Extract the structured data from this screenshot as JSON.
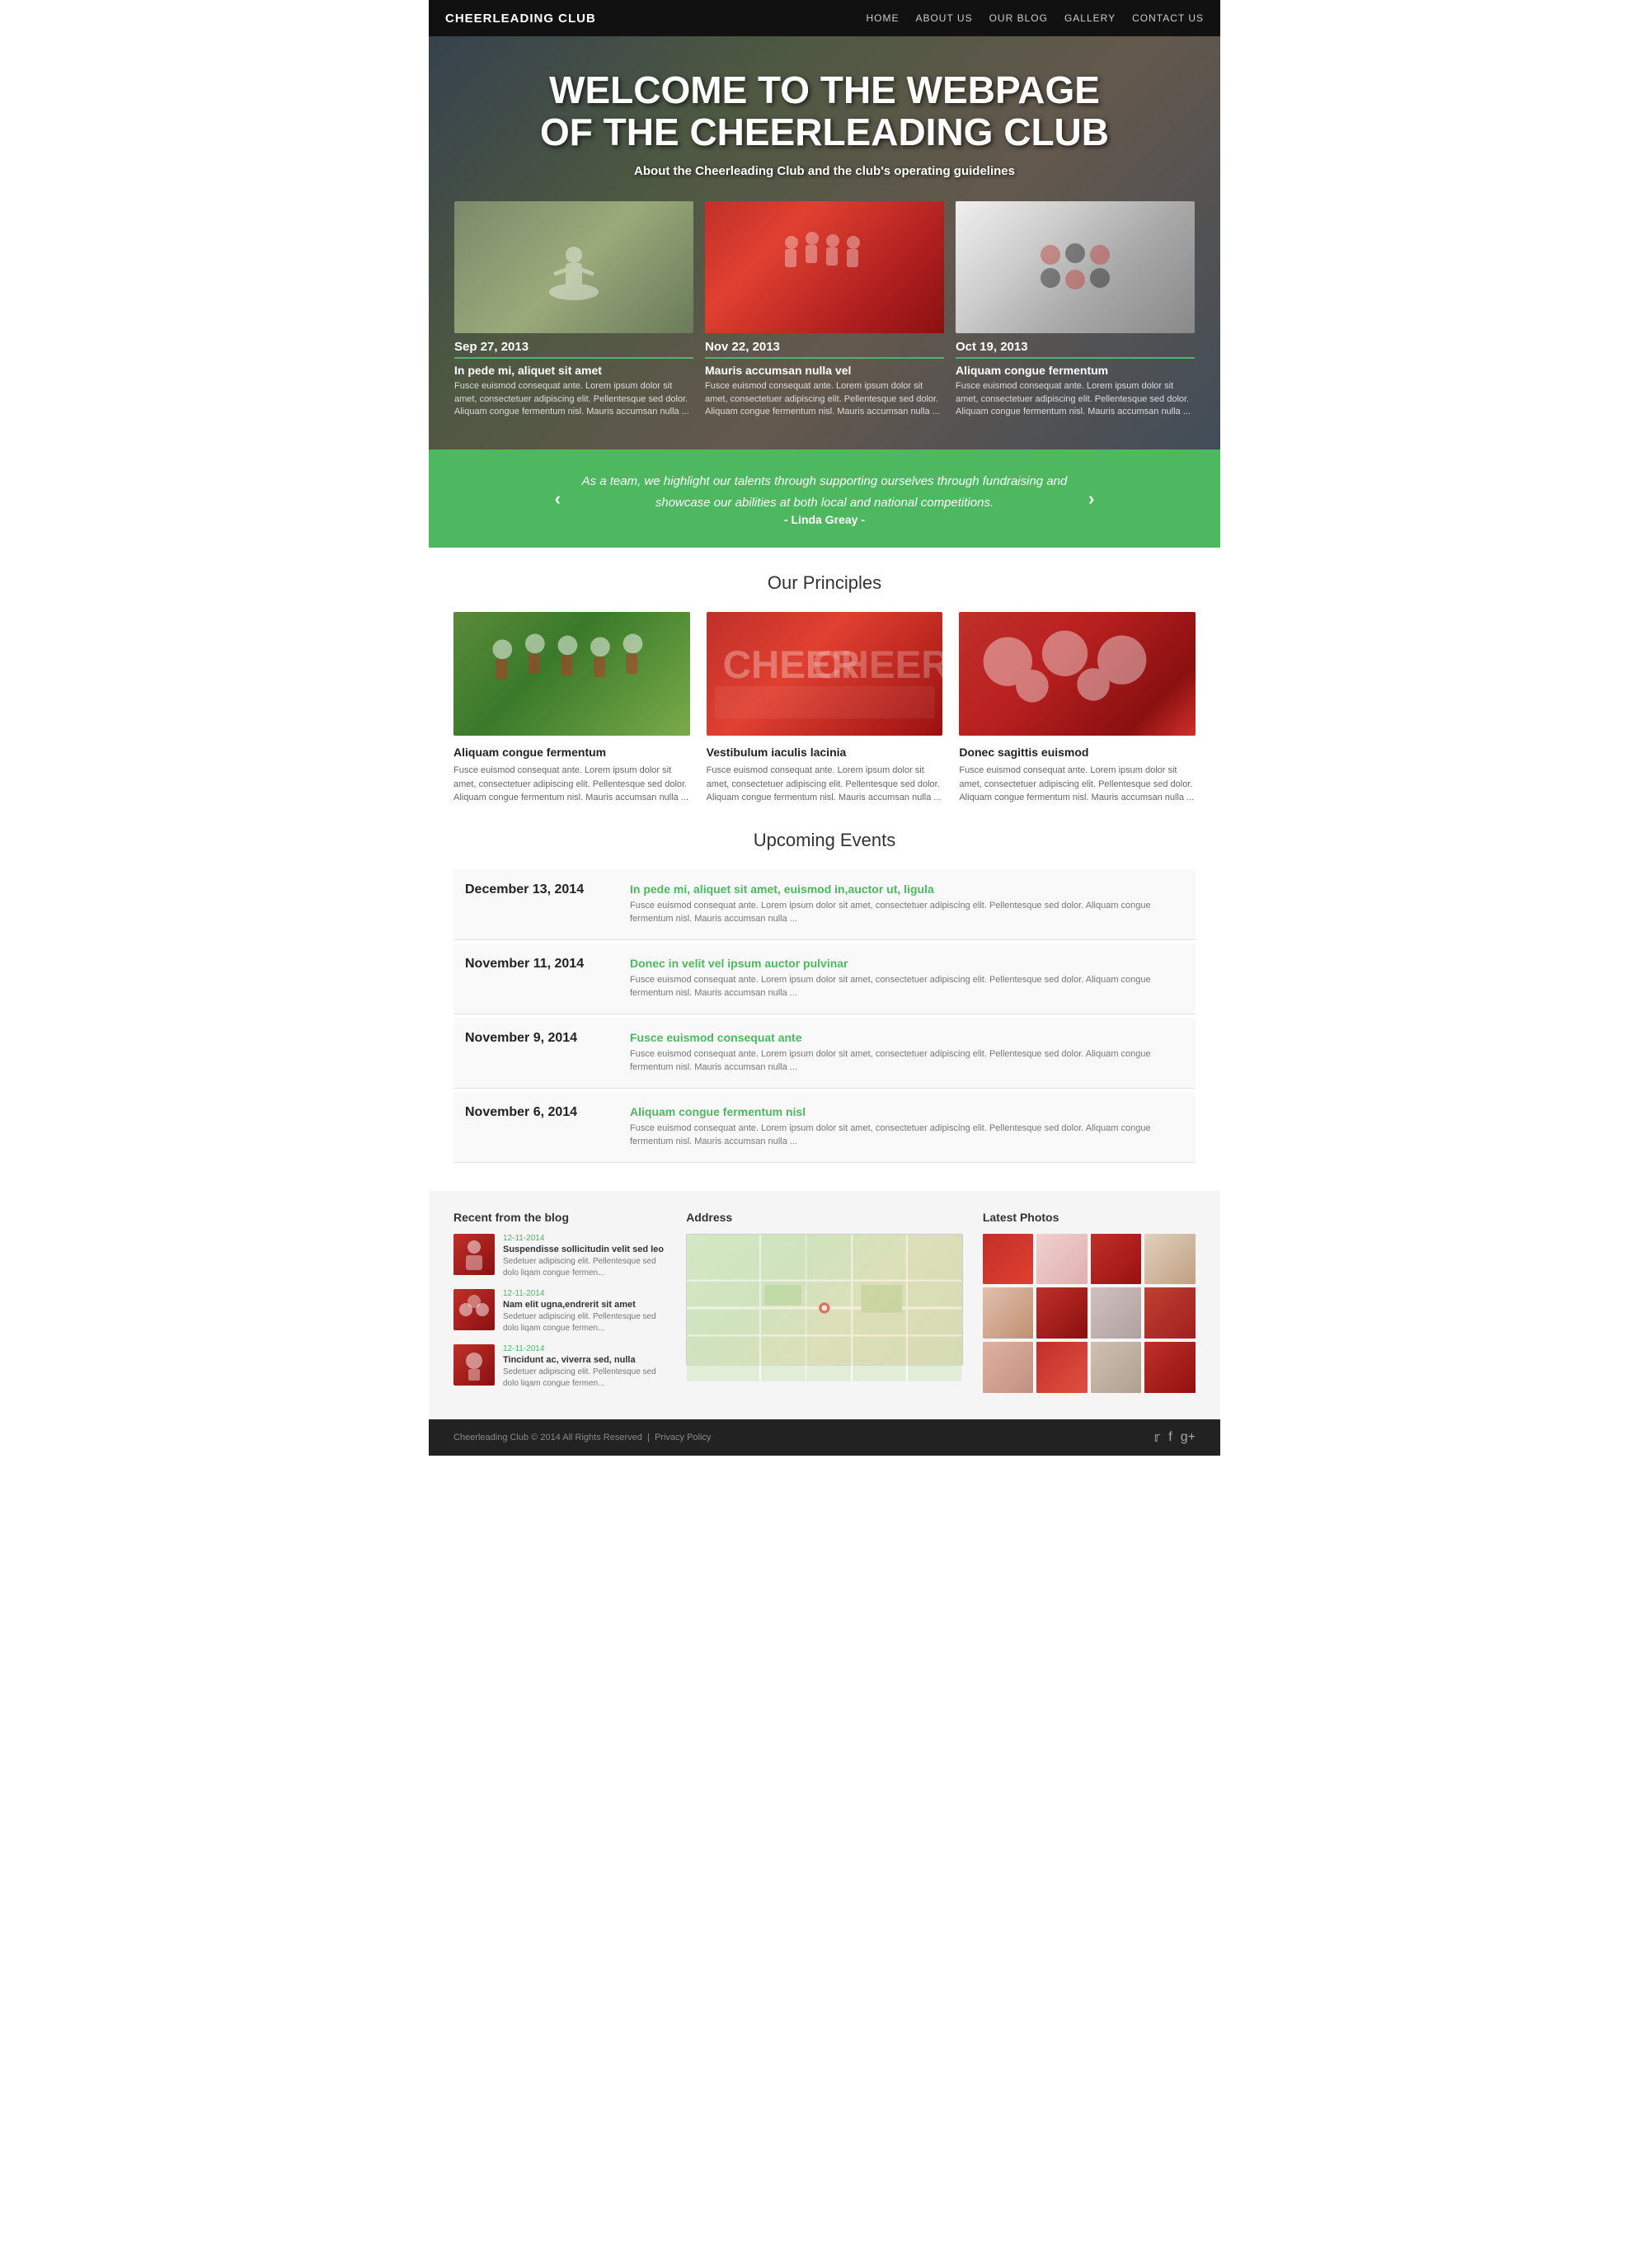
{
  "header": {
    "logo": "CHEERLEADING CLUB",
    "nav": [
      "HOME",
      "ABOUT US",
      "OUR BLOG",
      "GALLERY",
      "CONTACT US"
    ]
  },
  "hero": {
    "title": "WELCOME TO THE WEBPAGE OF THE CHEERLEADING CLUB",
    "subtitle": "About the Cheerleading Club and the club's operating guidelines",
    "cards": [
      {
        "date": "Sep 27, 2013",
        "title": "In pede mi, aliquet sit amet",
        "text": "Fusce euismod consequat ante. Lorem ipsum dolor sit amet, consectetuer adipiscing elit. Pellentesque sed dolor. Aliquam congue fermentum nisl. Mauris accumsan nulla ..."
      },
      {
        "date": "Nov 22, 2013",
        "title": "Mauris accumsan nulla vel",
        "text": "Fusce euismod consequat ante. Lorem ipsum dolor sit amet, consectetuer adipiscing elit. Pellentesque sed dolor. Aliquam congue fermentum nisl. Mauris accumsan nulla ..."
      },
      {
        "date": "Oct 19, 2013",
        "title": "Aliquam congue fermentum",
        "text": "Fusce euismod consequat ante. Lorem ipsum dolor sit amet, consectetuer adipiscing elit. Pellentesque sed dolor. Aliquam congue fermentum nisl. Mauris accumsan nulla ..."
      }
    ]
  },
  "quote": {
    "text": "As a team, we highlight our talents through supporting ourselves through fundraising and showcase our abilities at both local and national competitions.",
    "author": "- Linda Greay -"
  },
  "principles": {
    "title": "Our Principles",
    "items": [
      {
        "name": "Aliquam congue fermentum",
        "text": "Fusce euismod consequat ante. Lorem ipsum dolor sit amet, consectetuer adipiscing elit. Pellentesque sed dolor. Aliquam congue fermentum nisl. Mauris accumsan nulla ..."
      },
      {
        "name": "Vestibulum iaculis lacinia",
        "text": "Fusce euismod consequat ante. Lorem ipsum dolor sit amet, consectetuer adipiscing elit. Pellentesque sed dolor. Aliquam congue fermentum nisl. Mauris accumsan nulla ..."
      },
      {
        "name": "Donec sagittis euismod",
        "text": "Fusce euismod consequat ante. Lorem ipsum dolor sit amet, consectetuer adipiscing elit. Pellentesque sed dolor. Aliquam congue fermentum nisl. Mauris accumsan nulla ..."
      }
    ]
  },
  "events": {
    "title": "Upcoming Events",
    "items": [
      {
        "date": "December 13, 2014",
        "title": "In pede mi, aliquet sit amet, euismod in,auctor ut, ligula",
        "desc": "Fusce euismod consequat ante. Lorem ipsum dolor sit amet, consectetuer adipiscing elit. Pellentesque sed dolor. Aliquam congue fermentum nisl. Mauris accumsan nulla ..."
      },
      {
        "date": "November 11, 2014",
        "title": "Donec in velit vel ipsum auctor pulvinar",
        "desc": "Fusce euismod consequat ante. Lorem ipsum dolor sit amet, consectetuer adipiscing elit. Pellentesque sed dolor. Aliquam congue fermentum nisl. Mauris accumsan nulla ..."
      },
      {
        "date": "November 9, 2014",
        "title": "Fusce euismod consequat ante",
        "desc": "Fusce euismod consequat ante. Lorem ipsum dolor sit amet, consectetuer adipiscing elit. Pellentesque sed dolor. Aliquam congue fermentum nisl. Mauris accumsan nulla ..."
      },
      {
        "date": "November 6, 2014",
        "title": "Aliquam congue fermentum nisl",
        "desc": "Fusce euismod consequat ante. Lorem ipsum dolor sit amet, consectetuer adipiscing elit. Pellentesque sed dolor. Aliquam congue fermentum nisl. Mauris accumsan nulla ..."
      }
    ]
  },
  "footer": {
    "blog": {
      "title": "Recent from the blog",
      "items": [
        {
          "date": "12-11-2014",
          "title": "Suspendisse sollicitudin velit sed leo",
          "text": "Sedetuer adipiscing elit. Pellentesque sed dolo liqam congue fermen..."
        },
        {
          "date": "12-11-2014",
          "title": "Nam elit ugna,endrerit sit amet",
          "text": "Sedetuer adipiscing elit. Pellentesque sed dolo liqam congue fermen..."
        },
        {
          "date": "12-11-2014",
          "title": "Tincidunt ac, viverra sed, nulla",
          "text": "Sedetuer adipiscing elit. Pellentesque sed dolo liqam congue fermen..."
        }
      ]
    },
    "address": {
      "title": "Address"
    },
    "photos": {
      "title": "Latest Photos"
    },
    "copyright": "Cheerleading Club © 2014 All Rights Reserved",
    "privacy": "Privacy Policy",
    "social": [
      "twitter",
      "facebook",
      "google-plus"
    ]
  }
}
